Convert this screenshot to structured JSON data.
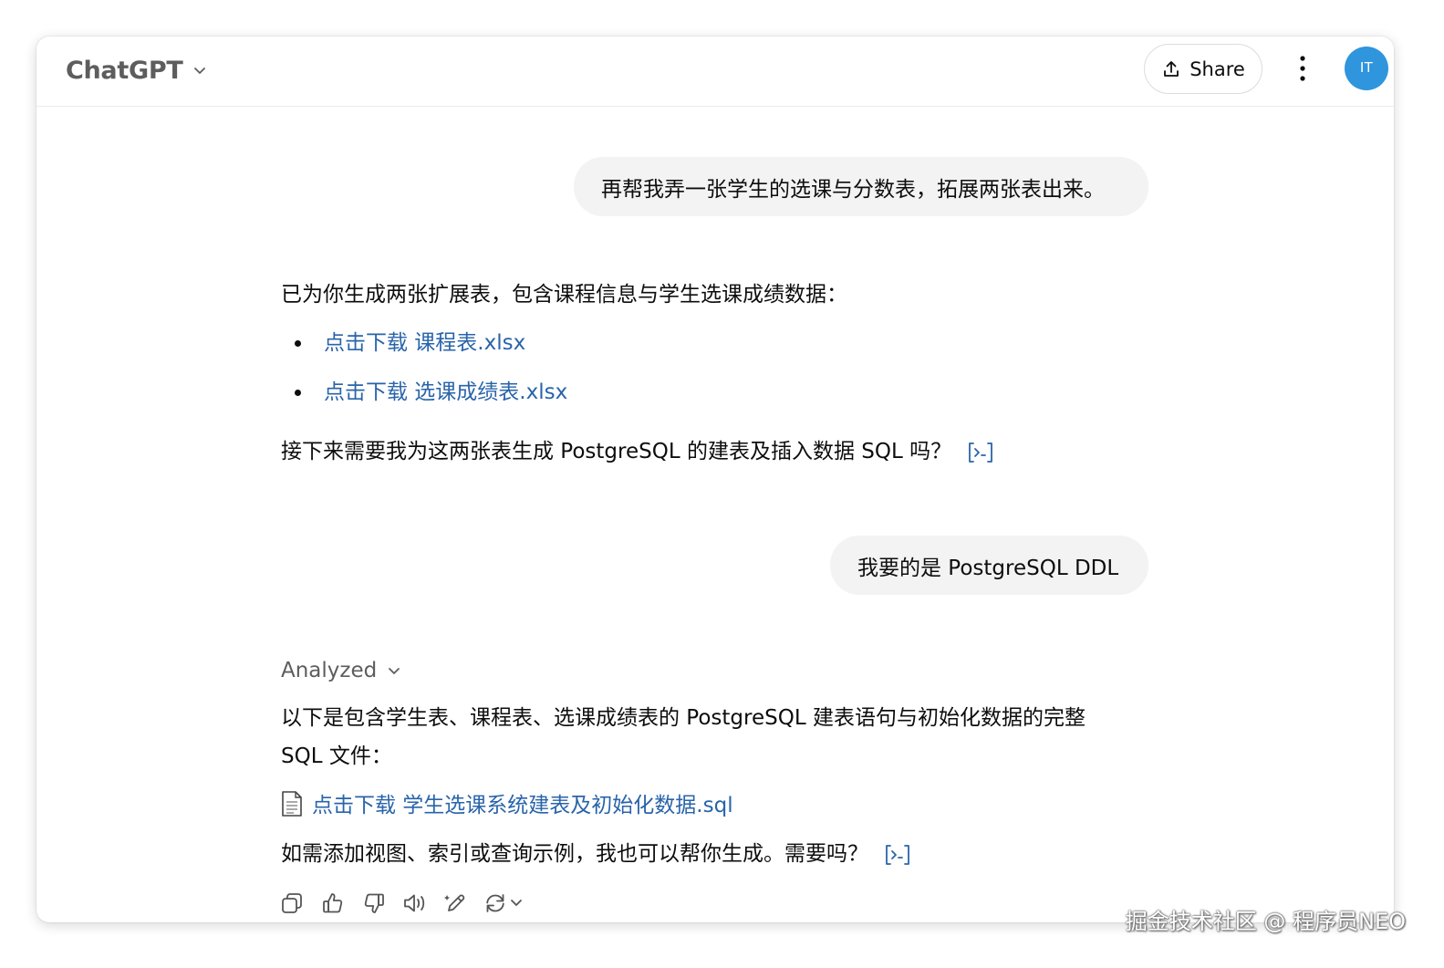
{
  "header": {
    "model_name": "ChatGPT",
    "share_label": "Share",
    "avatar_initials": "IT"
  },
  "messages": [
    {
      "role": "user",
      "text": "再帮我弄一张学生的选课与分数表，拓展两张表出来。"
    },
    {
      "role": "assistant",
      "intro": "已为你生成两张扩展表，包含课程信息与学生选课成绩数据：",
      "links": [
        "点击下载 课程表.xlsx",
        "点击下载 选课成绩表.xlsx"
      ],
      "outro": "接下来需要我为这两张表生成 PostgreSQL 的建表及插入数据 SQL 吗？"
    },
    {
      "role": "user",
      "text": "我要的是 PostgreSQL DDL"
    },
    {
      "role": "assistant",
      "analyzed_label": "Analyzed",
      "intro_line1": "以下是包含学生表、课程表、选课成绩表的 PostgreSQL 建表语句与初始化数据的完整",
      "intro_line2": "SQL 文件：",
      "file_link": "点击下载 学生选课系统建表及初始化数据.sql",
      "outro": "如需添加视图、索引或查询示例，我也可以帮你生成。需要吗？"
    }
  ],
  "icons": {
    "model_chevron": "chevron-down-icon",
    "share": "share-upload-icon",
    "more": "more-vertical-icon",
    "citation": "citation-bracket-icon",
    "file": "document-icon",
    "actions": [
      "copy-icon",
      "thumbs-up-icon",
      "thumbs-down-icon",
      "read-aloud-icon",
      "edit-icon",
      "regenerate-icon"
    ]
  },
  "watermark": "掘金技术社区 @ 程序员NEO",
  "colors": {
    "link": "#2964aa",
    "avatar_bg": "#2f95dc",
    "bubble_bg": "#f3f3f3",
    "muted_text": "#5d5d5d"
  }
}
